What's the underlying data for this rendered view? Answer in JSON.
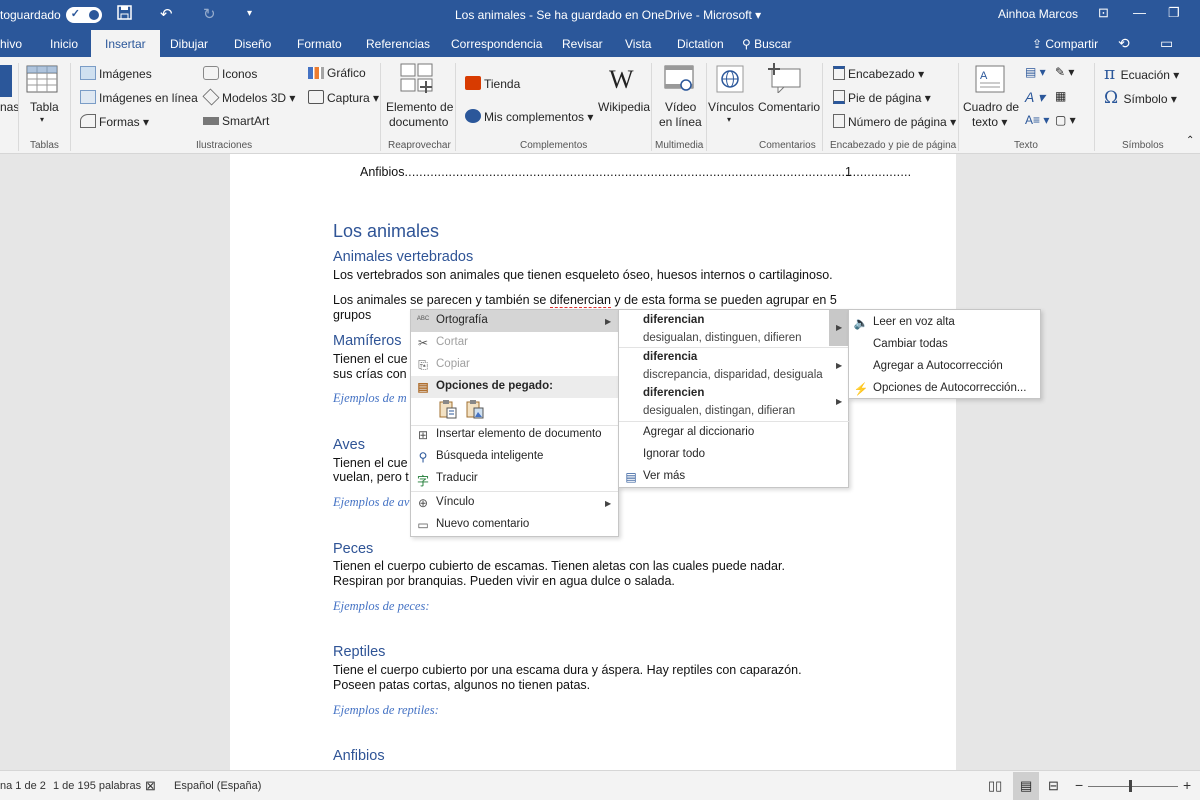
{
  "titlebar": {
    "autosave_label": "toguardado",
    "doc_title": "Los animales  -  Se ha guardado en OneDrive  -  Microsoft  ▾",
    "user": "Ainhoa Marcos"
  },
  "tabs": {
    "file": "hivo",
    "items": [
      "Inicio",
      "Insertar",
      "Dibujar",
      "Diseño",
      "Formato",
      "Referencias",
      "Correspondencia",
      "Revisar",
      "Vista",
      "Dictation"
    ],
    "search": "Buscar",
    "share": "Compartir"
  },
  "ribbon": {
    "left_partial": "nas",
    "tabla": "Tabla",
    "imagenes": "Imágenes",
    "imagenes_linea": "Imágenes en línea",
    "formas": "Formas",
    "iconos": "Iconos",
    "modelos3d": "Modelos 3D",
    "smartart": "SmartArt",
    "grafico": "Gráfico",
    "captura": "Captura",
    "elemento_doc_1": "Elemento de",
    "elemento_doc_2": "documento",
    "tienda": "Tienda",
    "mis_complementos": "Mis complementos",
    "wikipedia": "Wikipedia",
    "video_1": "Vídeo",
    "video_2": "en línea",
    "vinculos": "Vínculos",
    "comentario": "Comentario",
    "encabezado": "Encabezado",
    "pie_pagina": "Pie de página",
    "numero_pagina": "Número de página",
    "cuadro_texto_1": "Cuadro de",
    "cuadro_texto_2": "texto",
    "ecuacion": "Ecuación",
    "simbolo": "Símbolo",
    "groups": {
      "tablas": "Tablas",
      "ilustraciones": "Ilustraciones",
      "reaprovechar": "Reaprovechar",
      "complementos": "Complementos",
      "multimedia": "Multimedia",
      "comentarios": "Comentarios",
      "encabezado_pie": "Encabezado y pie de página",
      "texto": "Texto",
      "simbolos": "Símbolos"
    }
  },
  "document": {
    "toc_line": "Anfibios",
    "toc_dots": "..........................................................................................................................................",
    "toc_page": "1",
    "title": "Los animales",
    "h_vertebrados": "Animales vertebrados",
    "p_vertebrados": "Los vertebrados son animales que tienen esqueleto óseo, huesos internos o cartilaginoso.",
    "p_agrupar_1a": "Los animales se parecen y también se ",
    "p_agrupar_word": "difenercian",
    "p_agrupar_1b": " y de esta forma se pueden agrupar en 5",
    "p_agrupar_2": "grupos",
    "h_mamiferos": "Mamíferos",
    "p_mam_1": "Tienen el cue",
    "p_mam_2": "sus crías con",
    "ej_mam": "Ejemplos de m",
    "h_aves": "Aves",
    "p_aves_1": "Tienen el cue",
    "p_aves_2": "vuelan, pero t",
    "ej_aves": "Ejemplos de av",
    "h_peces": "Peces",
    "p_peces_1": "Tienen el cuerpo cubierto de escamas. Tienen aletas con las cuales puede nadar.",
    "p_peces_2": "Respiran por branquias. Pueden vivir en agua dulce o salada.",
    "ej_peces": "Ejemplos de peces:",
    "h_reptiles": "Reptiles",
    "p_rep_1": "Tiene el cuerpo cubierto por una escama dura y áspera. Hay reptiles con caparazón.",
    "p_rep_2": "Poseen patas cortas, algunos no tienen patas.",
    "ej_reptiles": "Ejemplos de reptiles:",
    "h_anfibios": "Anfibios"
  },
  "context_menu": {
    "ortografia": "Ortografía",
    "cortar": "Cortar",
    "copiar": "Copiar",
    "opciones_pegado": "Opciones de pegado:",
    "insertar_elemento": "Insertar elemento de documento",
    "busqueda": "Búsqueda inteligente",
    "traducir": "Traducir",
    "vinculo": "Vínculo",
    "nuevo_comentario": "Nuevo comentario"
  },
  "spelling_menu": {
    "s1_word": "diferencian",
    "s1_syn": "desigualan, distinguen, difieren",
    "s2_word": "diferencia",
    "s2_syn": "discrepancia, disparidad, desiguala",
    "s3_word": "diferencien",
    "s3_syn": "desigualen, distingan, difieran",
    "agregar_diccionario": "Agregar al diccionario",
    "ignorar_todo": "Ignorar todo",
    "ver_mas": "Ver más"
  },
  "sub_menu": {
    "leer": "Leer en voz alta",
    "cambiar": "Cambiar todas",
    "agregar_auto": "Agregar a Autocorrección",
    "opciones_auto": "Opciones de Autocorrección..."
  },
  "statusbar": {
    "page": "na 1 de 2",
    "words": "1 de 195 palabras",
    "language": "Español (España)"
  },
  "colors": {
    "brand": "#2b579a",
    "heading": "#2f5496",
    "emphasis": "#4472c4"
  }
}
